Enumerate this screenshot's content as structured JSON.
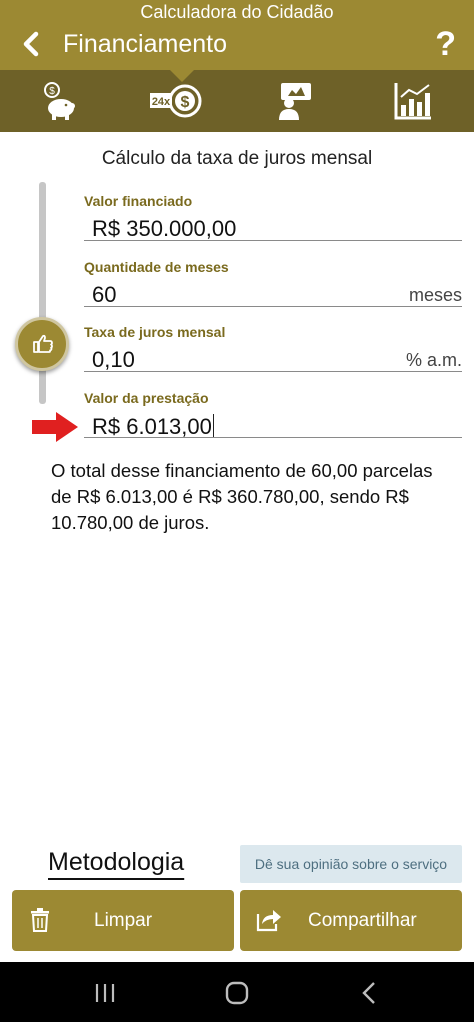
{
  "statusbar": {
    "text": "Calculadora do Cidadão"
  },
  "appbar": {
    "title": "Financiamento",
    "help": "?"
  },
  "tabs": [
    {
      "icon": "piggy-bank-icon"
    },
    {
      "icon": "installments-24x-icon",
      "badge": "24x",
      "active": true
    },
    {
      "icon": "presenter-icon"
    },
    {
      "icon": "chart-icon"
    }
  ],
  "section": {
    "title": "Cálculo da taxa de juros mensal"
  },
  "fields": {
    "valor_financiado": {
      "label": "Valor financiado",
      "value": "R$ 350.000,00"
    },
    "quantidade_meses": {
      "label": "Quantidade de meses",
      "value": "60",
      "unit": "meses"
    },
    "taxa_juros": {
      "label": "Taxa de juros mensal",
      "value": "0,10",
      "unit": "% a.m."
    },
    "valor_prestacao": {
      "label": "Valor da prestação",
      "value": "R$ 6.013,00"
    }
  },
  "summary": {
    "text": "O total desse financiamento de 60,00 parcelas de R$ 6.013,00 é R$ 360.780,00, sendo R$ 10.780,00 de juros."
  },
  "footer": {
    "metodologia": "Metodologia",
    "feedback": "Dê sua opinião sobre o serviço",
    "limpar": "Limpar",
    "compartilhar": "Compartilhar"
  },
  "colors": {
    "primary": "#9c8933",
    "tabbar": "#6e6128",
    "label": "#7a6a1e",
    "arrow": "#e02020",
    "feedback_bg": "#dce8ee"
  }
}
